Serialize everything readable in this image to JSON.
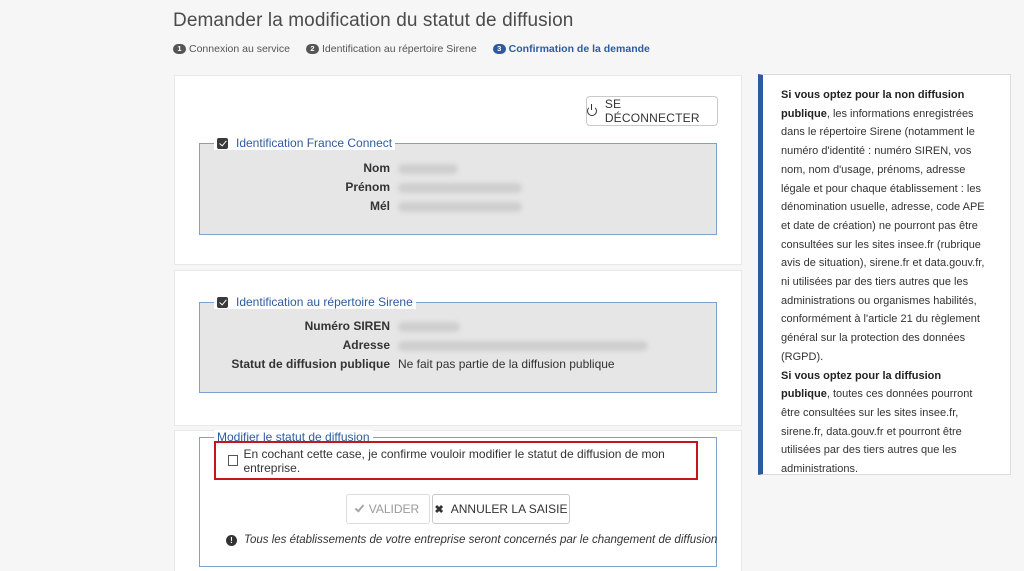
{
  "page": {
    "title": "Demander la modification du statut de diffusion"
  },
  "steps": [
    {
      "num": "1",
      "label": "Connexion au service"
    },
    {
      "num": "2",
      "label": "Identification au répertoire Sirene"
    },
    {
      "num": "3",
      "label": "Confirmation de la demande"
    }
  ],
  "logout": {
    "label": "SE DÉCONNECTER"
  },
  "france_connect": {
    "legend": "Identification France Connect",
    "rows": [
      {
        "label": "Nom",
        "value": ""
      },
      {
        "label": "Prénom",
        "value": ""
      },
      {
        "label": "Mél",
        "value": ""
      }
    ]
  },
  "sirene": {
    "legend": "Identification au répertoire Sirene",
    "rows": [
      {
        "label": "Numéro SIREN",
        "value": ""
      },
      {
        "label": "Adresse",
        "value": ""
      },
      {
        "label": "Statut de diffusion publique",
        "value": "Ne fait pas partie de la diffusion publique"
      }
    ]
  },
  "modify": {
    "legend": "Modifier le statut de diffusion",
    "confirm_text": "En cochant cette case, je confirme vouloir modifier le statut de diffusion de mon entreprise.",
    "validate_label": "VALIDER",
    "cancel_label": "ANNULER LA SAISIE",
    "info_text": "Tous les établissements de votre entreprise seront concernés par le changement de diffusion"
  },
  "side_panel": {
    "p1_bold": "Si vous optez pour la non diffusion publique",
    "p1_text": ", les informations enregistrées dans le répertoire Sirene (notamment le numéro d'identité : numéro SIREN, vos nom, nom d'usage, prénoms, adresse légale et pour chaque établissement : les dénomination usuelle, adresse, code APE et date de création) ne pourront pas être consultées sur les sites insee.fr (rubrique avis de situation), sirene.fr et data.gouv.fr, ni utilisées par des tiers autres que les administrations ou organismes habilités, conformément à l'article 21 du règlement général sur la protection des données (RGPD).",
    "p2_bold": "Si vous optez pour la diffusion publique",
    "p2_text": ", toutes ces données pourront être consultées sur les sites insee.fr, sirene.fr, data.gouv.fr et pourront être utilisées par des tiers autres que les administrations."
  },
  "colors": {
    "accent": "#2e5b9f",
    "highlight_border": "#c4161c"
  }
}
